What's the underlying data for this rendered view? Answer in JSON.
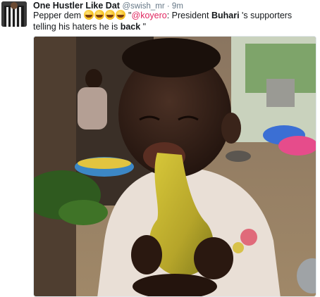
{
  "tweet": {
    "author_name": "One Hustler Like Dat",
    "author_handle": "@swish_mr",
    "separator": " · ",
    "time": "9m",
    "text_prefix": "Pepper dem ",
    "emoji_names": [
      "face-with-tears-of-joy-icon",
      "face-with-tears-of-joy-icon",
      "face-with-tears-of-joy-icon",
      "face-with-tears-of-joy-icon"
    ],
    "quote_open": " \"",
    "mention": "@koyero",
    "text_mid": ": President ",
    "bold_1": "Buhari",
    "text_mid2": " 's supporters telling his haters he is ",
    "bold_2": "back",
    "quote_close": " \""
  },
  "colors": {
    "mention": "#e0245e",
    "meta": "#657786",
    "text": "#14171a"
  }
}
